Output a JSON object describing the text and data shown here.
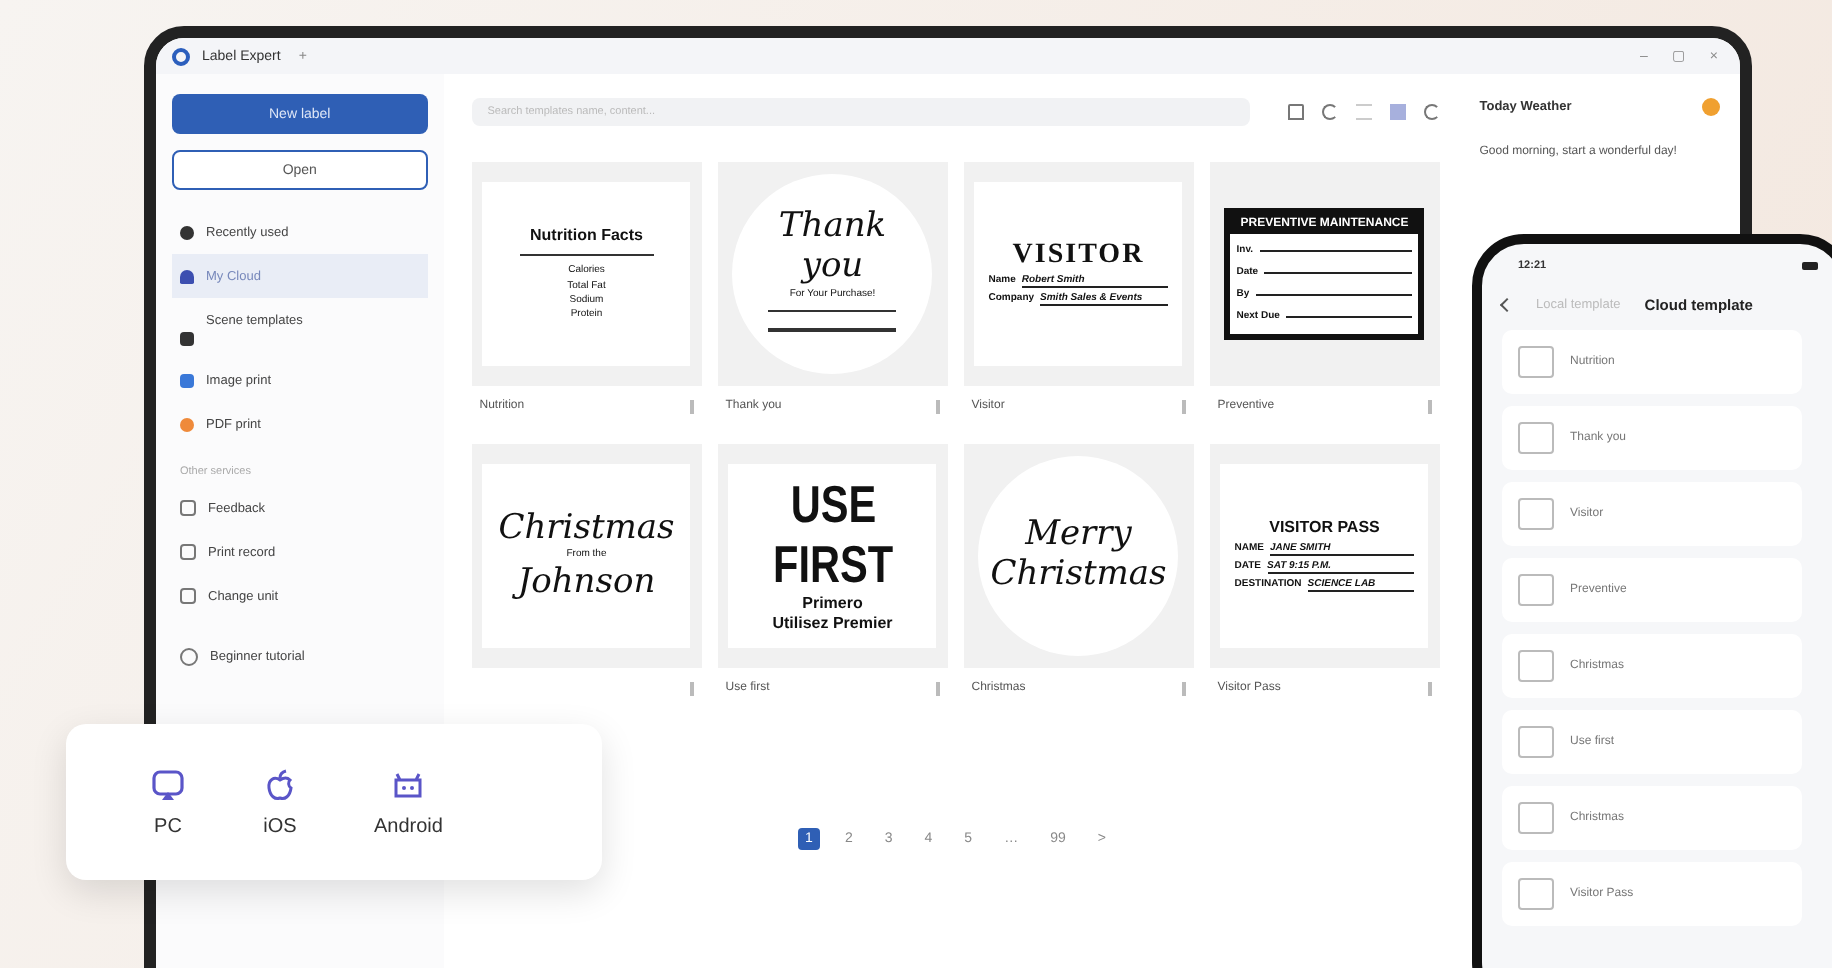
{
  "window": {
    "title": "Label Expert",
    "tab_add": "+",
    "controls": [
      "–",
      "▢",
      "×"
    ]
  },
  "sidebar": {
    "primary": {
      "label": "New label"
    },
    "secondary": {
      "label": "Open"
    },
    "items": [
      {
        "label": "Recently used",
        "selected": false
      },
      {
        "label": "My Cloud",
        "selected": true
      },
      {
        "label": "Scene templates",
        "selected": false
      }
    ],
    "print_items": [
      {
        "label": "Image print"
      },
      {
        "label": "PDF print"
      }
    ],
    "section_title": "Other services",
    "services": [
      {
        "label": "Feedback"
      },
      {
        "label": "Print record"
      },
      {
        "label": "Change unit"
      }
    ],
    "tutorial": {
      "label": "Beginner tutorial"
    }
  },
  "search": {
    "placeholder": "Search templates name, content..."
  },
  "view": {
    "list_selected": false,
    "grid_selected": true
  },
  "cards": [
    {
      "title": "Nutrition",
      "kind": "square",
      "lines": [
        {
          "kind": "heading",
          "text": "Nutrition Facts"
        },
        {
          "kind": "rule"
        },
        {
          "kind": "small",
          "text": "Calories"
        },
        {
          "kind": "small",
          "text": "Total Fat"
        },
        {
          "kind": "small",
          "text": "Sodium"
        },
        {
          "kind": "small",
          "text": "Protein"
        }
      ]
    },
    {
      "title": "Thank you",
      "kind": "circle",
      "lines": [
        {
          "kind": "script",
          "text": "Thank"
        },
        {
          "kind": "script",
          "text": "you"
        },
        {
          "kind": "small",
          "text": "For Your Purchase!"
        },
        {
          "kind": "rule"
        },
        {
          "kind": "rule"
        }
      ]
    },
    {
      "title": "Visitor",
      "kind": "square",
      "lines": [
        {
          "kind": "serif",
          "text": "VISITOR"
        },
        {
          "kind": "field",
          "label": "Name",
          "text": "Robert Smith"
        },
        {
          "kind": "field",
          "label": "Company",
          "text": "Smith Sales & Events"
        }
      ]
    },
    {
      "title": "Preventive",
      "kind": "boxed",
      "lines": [
        {
          "kind": "bar",
          "text": "PREVENTIVE MAINTENANCE"
        },
        {
          "kind": "field",
          "label": "Inv."
        },
        {
          "kind": "field",
          "label": "Date"
        },
        {
          "kind": "field",
          "label": "By"
        },
        {
          "kind": "field",
          "label": "Next Due"
        }
      ]
    },
    {
      "kind": "square",
      "lines": [
        {
          "kind": "script",
          "text": "Christmas"
        },
        {
          "kind": "small",
          "text": "From the"
        },
        {
          "kind": "script",
          "text": "Johnson"
        }
      ]
    },
    {
      "title": "Use first",
      "kind": "square",
      "lines": [
        {
          "kind": "huge",
          "text": "USE"
        },
        {
          "kind": "huge",
          "text": "FIRST"
        },
        {
          "kind": "heading",
          "text": "Primero"
        },
        {
          "kind": "heading",
          "text": "Utilisez Premier"
        }
      ]
    },
    {
      "title": "Christmas",
      "kind": "circle",
      "lines": [
        {
          "kind": "script",
          "text": "Merry"
        },
        {
          "kind": "script",
          "text": "Christmas"
        }
      ]
    },
    {
      "title": "Visitor Pass",
      "kind": "square",
      "lines": [
        {
          "kind": "heading",
          "text": "VISITOR PASS"
        },
        {
          "kind": "field",
          "label": "NAME",
          "text": "JANE SMITH"
        },
        {
          "kind": "field",
          "label": "DATE",
          "text": "SAT 9:15 P.M."
        },
        {
          "kind": "field",
          "label": "DESTINATION",
          "text": "SCIENCE LAB"
        }
      ]
    }
  ],
  "pagination": [
    {
      "label": "1",
      "selected": true
    },
    {
      "label": "2",
      "selected": false
    },
    {
      "label": "3",
      "selected": false
    },
    {
      "label": "4",
      "selected": false
    },
    {
      "label": "5",
      "selected": false
    },
    {
      "label": "…",
      "selected": false
    },
    {
      "label": "99",
      "selected": false
    },
    {
      "label": ">",
      "selected": false
    }
  ],
  "weather": {
    "title": "Today Weather",
    "greeting": "Good morning, start a wonderful day!"
  },
  "phone": {
    "time": "12:21",
    "tabs": [
      {
        "label": "Local template",
        "selected": false
      },
      {
        "label": "Cloud template",
        "selected": true
      }
    ],
    "items": [
      {
        "label": "Nutrition"
      },
      {
        "label": "Thank you"
      },
      {
        "label": "Visitor"
      },
      {
        "label": "Preventive"
      },
      {
        "label": "Christmas"
      },
      {
        "label": "Use first"
      },
      {
        "label": "Christmas"
      },
      {
        "label": "Visitor Pass"
      }
    ]
  },
  "platforms": [
    {
      "label": "PC"
    },
    {
      "label": "iOS"
    },
    {
      "label": "Android"
    }
  ]
}
